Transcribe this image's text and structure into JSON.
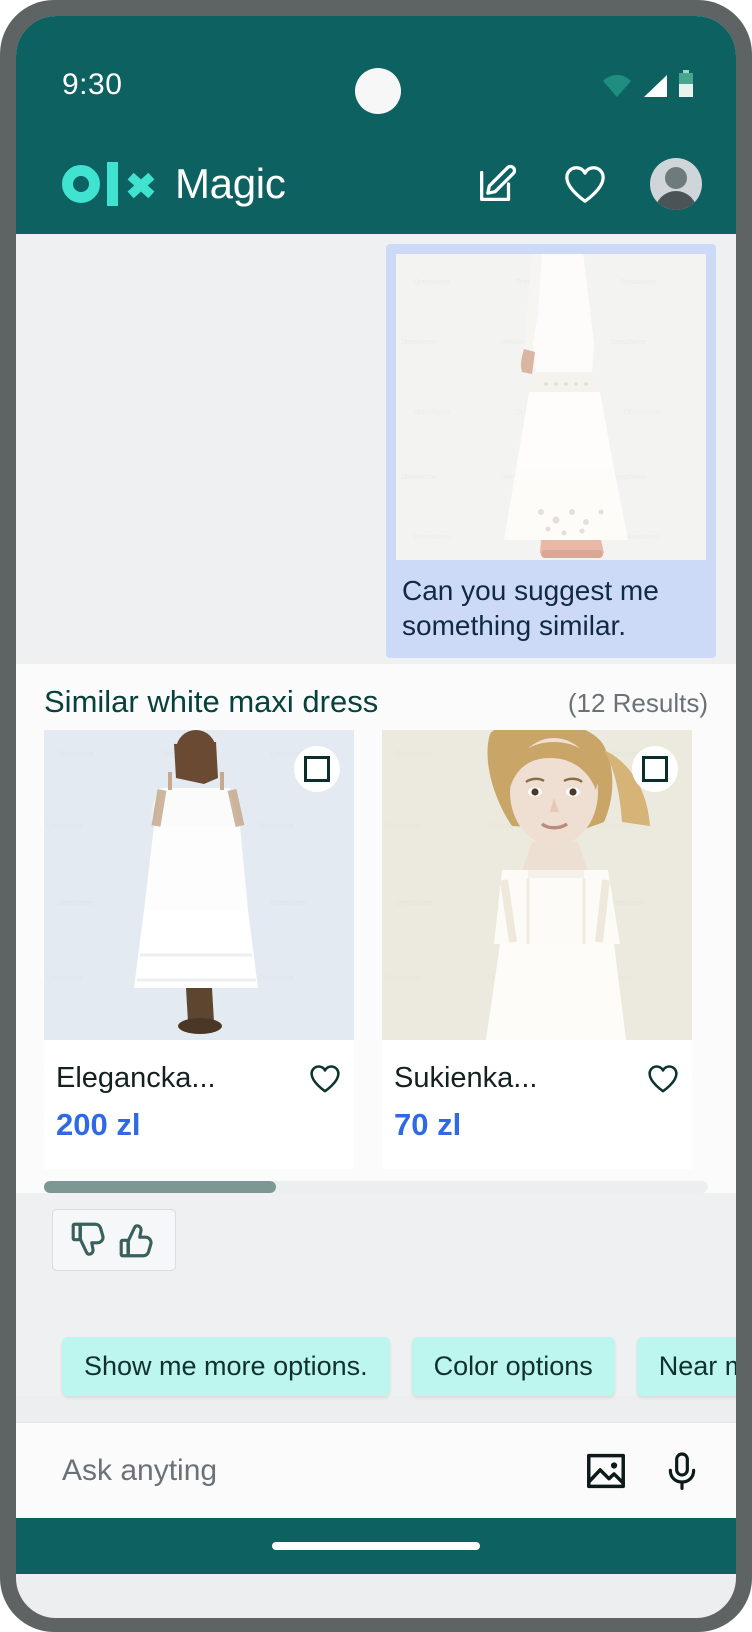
{
  "status_bar": {
    "time": "9:30",
    "icons": [
      "wifi-icon",
      "cellular-signal-icon",
      "battery-icon"
    ]
  },
  "app_bar": {
    "brand_logo": "olx-logo",
    "brand_name": "Magic",
    "actions": [
      {
        "name": "compose-icon",
        "label": "Compose"
      },
      {
        "name": "favorites-heart-icon",
        "label": "Favorites"
      },
      {
        "name": "profile-avatar",
        "label": "Profile"
      }
    ],
    "bg_color": "#0e6161",
    "logo_color": "#3fe3d0"
  },
  "chat": {
    "user_message": {
      "image_alt": "white maxi dress photo",
      "text": "Can you suggest me something similar.",
      "bubble_color": "#ccd9f7"
    }
  },
  "results": {
    "title": "Similar white maxi dress",
    "count_label": "(12 Results)",
    "products": [
      {
        "title": "Elegancka...",
        "price": "200 zl",
        "checkbox_checked": false,
        "favorite": false
      },
      {
        "title": "Sukienka...",
        "price": "70 zl",
        "checkbox_checked": false,
        "favorite": false
      }
    ],
    "price_color": "#2f6ae4",
    "scroll_position_percent": 36
  },
  "feedback": {
    "thumbs_down": "thumbs-down-icon",
    "thumbs_up": "thumbs-up-icon"
  },
  "suggestion_chips": [
    {
      "label": "Show me more options."
    },
    {
      "label": "Color options"
    },
    {
      "label": "Near me"
    }
  ],
  "chip_color": "#bdf5ef",
  "input": {
    "placeholder": "Ask anyting",
    "value": "",
    "actions": [
      {
        "name": "image-attach-icon"
      },
      {
        "name": "microphone-icon"
      }
    ]
  },
  "nav_bar": {
    "home_indicator": true
  }
}
